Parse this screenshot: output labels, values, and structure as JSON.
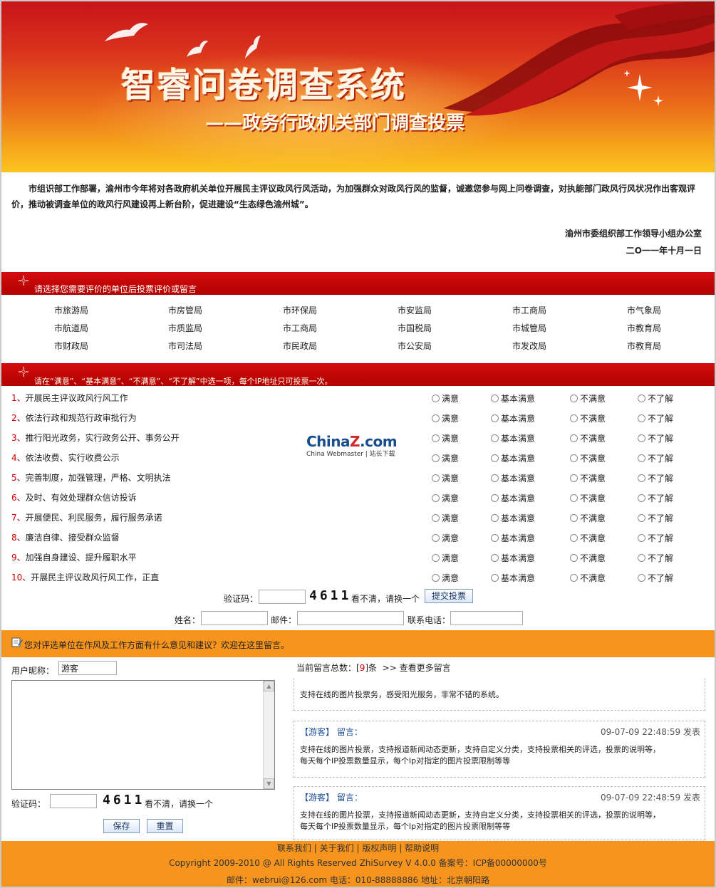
{
  "banner": {
    "title": "智睿问卷调查系统",
    "subtitle": "——政务行政机关部门调查投票"
  },
  "intro": {
    "text": "市组识部工作部署，渝州市今年将对各政府机关单位开展民主评议政风行风活动，为加强群众对政风行风的监督，诚邀您参与网上问卷调查，对执能部门政风行风状况作出客观评价，推动被调查单位的政风行风建设再上新台阶，促进建设“生态绿色渝州城”。",
    "signer": "渝州市委组织部工作领导小组办公室",
    "date": "二O一一年十月一日"
  },
  "unit_section": {
    "heading": "请选择您需要评价的单位后投票评价或留言",
    "units": [
      [
        "市旅游局",
        "市房管局",
        "市环保局",
        "市安监局",
        "市工商局",
        "市气象局"
      ],
      [
        "市航道局",
        "市质监局",
        "市工商局",
        "市国税局",
        "市城管局",
        "市教育局"
      ],
      [
        "市财政局",
        "市司法局",
        "市民政局",
        "市公安局",
        "市发改局",
        "市教育局"
      ]
    ]
  },
  "vote_section": {
    "heading": "请在“满意”、“基本满意”、“不满意”、“不了解”中选一项，每个IP地址只可投票一次。",
    "options": [
      "满意",
      "基本满意",
      "不满意",
      "不了解"
    ],
    "questions": [
      {
        "num": "1、",
        "text": "开展民主评议政风行风工作"
      },
      {
        "num": "2、",
        "text": "依法行政和规范行政审批行为"
      },
      {
        "num": "3、",
        "text": "推行阳光政务，实行政务公开、事务公开"
      },
      {
        "num": "4、",
        "text": "依法收费、实行收费公示"
      },
      {
        "num": "5、",
        "text": "完善制度，加强管理，严格、文明执法"
      },
      {
        "num": "6、",
        "text": "及时、有效处理群众信访投诉"
      },
      {
        "num": "7、",
        "text": "开展便民、利民服务，履行服务承诺"
      },
      {
        "num": "8、",
        "text": "廉洁自律、接受群众监督"
      },
      {
        "num": "9、",
        "text": "加强自身建设、提升履职水平"
      },
      {
        "num": "10、",
        "text": "开展民主评议政风行风工作，正直"
      }
    ],
    "captcha_label": "验证码：",
    "captcha_code": "4611",
    "refresh_text": "看不清，请换一个",
    "submit_label": "提交投票",
    "name_label": "姓名：",
    "email_label": "邮件：",
    "phone_label": "联系电话："
  },
  "watermark": {
    "logo_a": "China",
    "logo_b": "Z",
    "logo_c": ".com",
    "tagline": "China Webmaster | 站长下载"
  },
  "message_section": {
    "heading": "您对评选单位在作风及工作方面有什么意见和建议？欢迎在这里留言。",
    "nickname_label": "用户昵称：",
    "nickname_value": "游客",
    "captcha_label": "验证码：",
    "captcha_code": "4611",
    "refresh_text": "看不清，请换一个",
    "save_label": "保存",
    "reset_label": "重置",
    "count_prefix": "当前留言总数：[",
    "count_value": "9",
    "count_suffix": "]条",
    "more_link": ">> 查看更多留言",
    "notice": "支持在线的图片投票务，感受阳光服务，非常不错的系统。",
    "messages": [
      {
        "head": "【游客】 留言：",
        "time": "09-07-09 22:48:59 发表",
        "line1": "支持在线的图片投票，支持报道新闻动态更新，支持自定义分类，支持投票相关的评选，投票的说明等，",
        "line2": "每天每个IP投票数量显示，每个Ip对指定的图片投票限制等等"
      },
      {
        "head": "【游客】 留言：",
        "time": "09-07-09 22:48:59 发表",
        "line1": "支持在线的图片投票，支持报道新闻动态更新，支持自定义分类，支持投票相关的评选，投票的说明等，",
        "line2": "每天每个IP投票数量显示，每个Ip对指定的图片投票限制等等"
      }
    ]
  },
  "footer": {
    "links": [
      "联系我们",
      "关于我们",
      "版权声明",
      "帮助说明"
    ],
    "separator": "|",
    "copyright": "Copyright 2009-2010 @ All Rights Reserved ZhiSurvey V 4.0.0 备案号：ICP备00000000号",
    "contact": "邮件：webrui@126.com 电话：010-88888886    地址：北京朝阳路"
  },
  "colors": {
    "red_bar": "#c40606",
    "orange": "#f7941d",
    "question_number": "#cc0000",
    "link_blue": "#1f4f9a"
  }
}
